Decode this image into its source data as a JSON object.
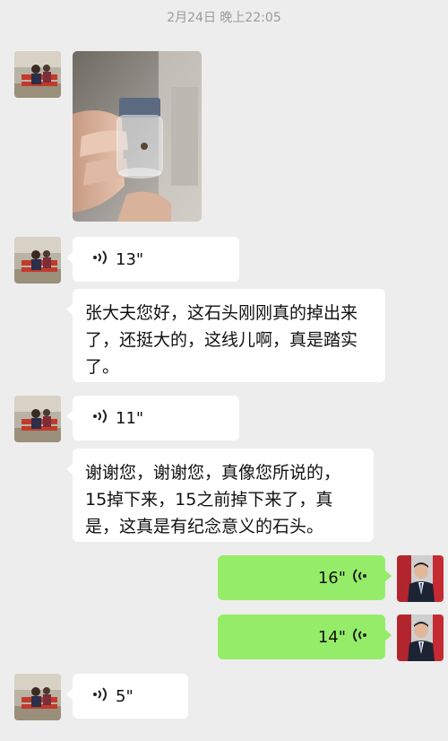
{
  "chat": {
    "timestamp": "2月24日 晚上22:05",
    "messages": [
      {
        "type": "image",
        "from": "other",
        "description": "photo"
      },
      {
        "type": "voice",
        "from": "other",
        "duration": "13\""
      },
      {
        "type": "text",
        "from": "other",
        "text": "张大夫您好，这石头刚刚真的掉出来了，还挺大的，这线儿啊，真是踏实了。"
      },
      {
        "type": "voice",
        "from": "other",
        "duration": "11\""
      },
      {
        "type": "text",
        "from": "other",
        "text": "谢谢您，谢谢您，真像您所说的，15掉下来，15之前掉下来了，真是，这真是有纪念意义的石头。"
      },
      {
        "type": "voice",
        "from": "me",
        "duration": "16\""
      },
      {
        "type": "voice",
        "from": "me",
        "duration": "14\""
      },
      {
        "type": "voice",
        "from": "other",
        "duration": "5\""
      }
    ]
  },
  "colors": {
    "background": "#ededed",
    "incoming_bubble": "#ffffff",
    "outgoing_bubble": "#95ec69",
    "timestamp": "#9a9a9a"
  }
}
